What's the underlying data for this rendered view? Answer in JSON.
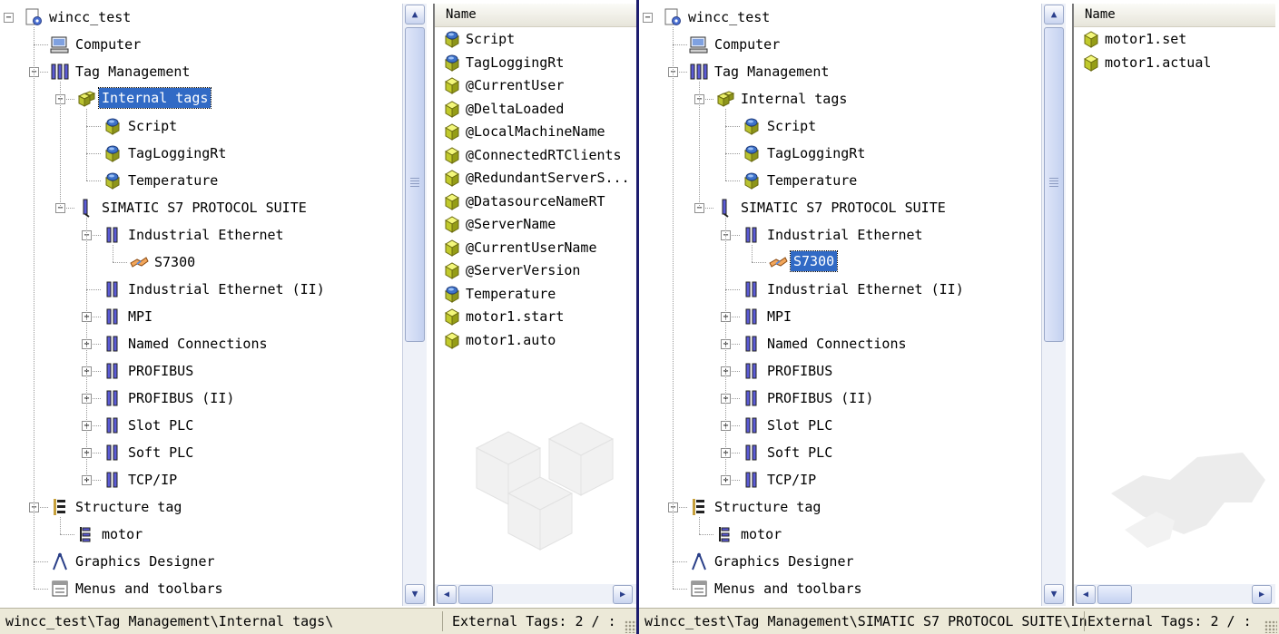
{
  "left": {
    "tree": [
      {
        "label": "wincc_test",
        "icon": "project-icon",
        "depth": 0,
        "expander": "minus"
      },
      {
        "label": "Computer",
        "icon": "computer-icon",
        "depth": 1,
        "expander": ""
      },
      {
        "label": "Tag Management",
        "icon": "tag-management-icon",
        "depth": 1,
        "expander": "minus"
      },
      {
        "label": "Internal tags",
        "icon": "internal-tags-icon",
        "depth": 2,
        "expander": "minus",
        "selected": true
      },
      {
        "label": "Script",
        "icon": "tag-group-icon",
        "depth": 3,
        "expander": ""
      },
      {
        "label": "TagLoggingRt",
        "icon": "tag-group-icon",
        "depth": 3,
        "expander": ""
      },
      {
        "label": "Temperature",
        "icon": "tag-group-icon",
        "depth": 3,
        "expander": ""
      },
      {
        "label": "SIMATIC S7 PROTOCOL SUITE",
        "icon": "driver-icon",
        "depth": 2,
        "expander": "minus"
      },
      {
        "label": "Industrial Ethernet",
        "icon": "channel-icon",
        "depth": 3,
        "expander": "minus"
      },
      {
        "label": "S7300",
        "icon": "connection-icon",
        "depth": 4,
        "expander": ""
      },
      {
        "label": "Industrial Ethernet (II)",
        "icon": "channel-icon",
        "depth": 3,
        "expander": ""
      },
      {
        "label": "MPI",
        "icon": "channel-icon",
        "depth": 3,
        "expander": "plus"
      },
      {
        "label": "Named Connections",
        "icon": "channel-icon",
        "depth": 3,
        "expander": "plus"
      },
      {
        "label": "PROFIBUS",
        "icon": "channel-icon",
        "depth": 3,
        "expander": "plus"
      },
      {
        "label": "PROFIBUS (II)",
        "icon": "channel-icon",
        "depth": 3,
        "expander": "plus"
      },
      {
        "label": "Slot PLC",
        "icon": "channel-icon",
        "depth": 3,
        "expander": "plus"
      },
      {
        "label": "Soft PLC",
        "icon": "channel-icon",
        "depth": 3,
        "expander": "plus"
      },
      {
        "label": "TCP/IP",
        "icon": "channel-icon",
        "depth": 3,
        "expander": "plus"
      },
      {
        "label": "Structure tag",
        "icon": "structure-icon",
        "depth": 1,
        "expander": "minus"
      },
      {
        "label": "motor",
        "icon": "structure-type-icon",
        "depth": 2,
        "expander": ""
      },
      {
        "label": "Graphics Designer",
        "icon": "graphics-designer-icon",
        "depth": 1,
        "expander": ""
      },
      {
        "label": "Menus and toolbars",
        "icon": "menus-icon",
        "depth": 1,
        "expander": ""
      }
    ],
    "list_header": "Name",
    "list": [
      {
        "label": "Script",
        "icon": "tag-group-icon"
      },
      {
        "label": "TagLoggingRt",
        "icon": "tag-group-icon"
      },
      {
        "label": "@CurrentUser",
        "icon": "tag-icon"
      },
      {
        "label": "@DeltaLoaded",
        "icon": "tag-icon"
      },
      {
        "label": "@LocalMachineName",
        "icon": "tag-icon"
      },
      {
        "label": "@ConnectedRTClients",
        "icon": "tag-icon"
      },
      {
        "label": "@RedundantServerS...",
        "icon": "tag-icon"
      },
      {
        "label": "@DatasourceNameRT",
        "icon": "tag-icon"
      },
      {
        "label": "@ServerName",
        "icon": "tag-icon"
      },
      {
        "label": "@CurrentUserName",
        "icon": "tag-icon"
      },
      {
        "label": "@ServerVersion",
        "icon": "tag-icon"
      },
      {
        "label": "Temperature",
        "icon": "tag-group-icon"
      },
      {
        "label": "motor1.start",
        "icon": "tag-icon"
      },
      {
        "label": "motor1.auto",
        "icon": "tag-icon"
      }
    ],
    "status_path": "wincc_test\\Tag Management\\Internal tags\\",
    "status_ext": "External Tags: 2 / :"
  },
  "right": {
    "tree": [
      {
        "label": "wincc_test",
        "icon": "project-icon",
        "depth": 0,
        "expander": "minus"
      },
      {
        "label": "Computer",
        "icon": "computer-icon",
        "depth": 1,
        "expander": ""
      },
      {
        "label": "Tag Management",
        "icon": "tag-management-icon",
        "depth": 1,
        "expander": "minus"
      },
      {
        "label": "Internal tags",
        "icon": "internal-tags-icon",
        "depth": 2,
        "expander": "minus"
      },
      {
        "label": "Script",
        "icon": "tag-group-icon",
        "depth": 3,
        "expander": ""
      },
      {
        "label": "TagLoggingRt",
        "icon": "tag-group-icon",
        "depth": 3,
        "expander": ""
      },
      {
        "label": "Temperature",
        "icon": "tag-group-icon",
        "depth": 3,
        "expander": ""
      },
      {
        "label": "SIMATIC S7 PROTOCOL SUITE",
        "icon": "driver-icon",
        "depth": 2,
        "expander": "minus"
      },
      {
        "label": "Industrial Ethernet",
        "icon": "channel-icon",
        "depth": 3,
        "expander": "minus"
      },
      {
        "label": "S7300",
        "icon": "connection-icon",
        "depth": 4,
        "expander": "",
        "selected": true
      },
      {
        "label": "Industrial Ethernet (II)",
        "icon": "channel-icon",
        "depth": 3,
        "expander": ""
      },
      {
        "label": "MPI",
        "icon": "channel-icon",
        "depth": 3,
        "expander": "plus"
      },
      {
        "label": "Named Connections",
        "icon": "channel-icon",
        "depth": 3,
        "expander": "plus"
      },
      {
        "label": "PROFIBUS",
        "icon": "channel-icon",
        "depth": 3,
        "expander": "plus"
      },
      {
        "label": "PROFIBUS (II)",
        "icon": "channel-icon",
        "depth": 3,
        "expander": "plus"
      },
      {
        "label": "Slot PLC",
        "icon": "channel-icon",
        "depth": 3,
        "expander": "plus"
      },
      {
        "label": "Soft PLC",
        "icon": "channel-icon",
        "depth": 3,
        "expander": "plus"
      },
      {
        "label": "TCP/IP",
        "icon": "channel-icon",
        "depth": 3,
        "expander": "plus"
      },
      {
        "label": "Structure tag",
        "icon": "structure-icon",
        "depth": 1,
        "expander": "minus"
      },
      {
        "label": "motor",
        "icon": "structure-type-icon",
        "depth": 2,
        "expander": ""
      },
      {
        "label": "Graphics Designer",
        "icon": "graphics-designer-icon",
        "depth": 1,
        "expander": ""
      },
      {
        "label": "Menus and toolbars",
        "icon": "menus-icon",
        "depth": 1,
        "expander": ""
      }
    ],
    "list_header": "Name",
    "list": [
      {
        "label": "motor1.set",
        "icon": "tag-icon"
      },
      {
        "label": "motor1.actual",
        "icon": "tag-icon"
      }
    ],
    "status_path": "wincc_test\\Tag Management\\SIMATIC S7 PROTOCOL SUITE\\In",
    "status_ext": "External Tags: 2 / :"
  },
  "colors": {
    "selection": "#316ac5",
    "status_bar": "#ece9d8",
    "divider": "#1c1c6e"
  }
}
